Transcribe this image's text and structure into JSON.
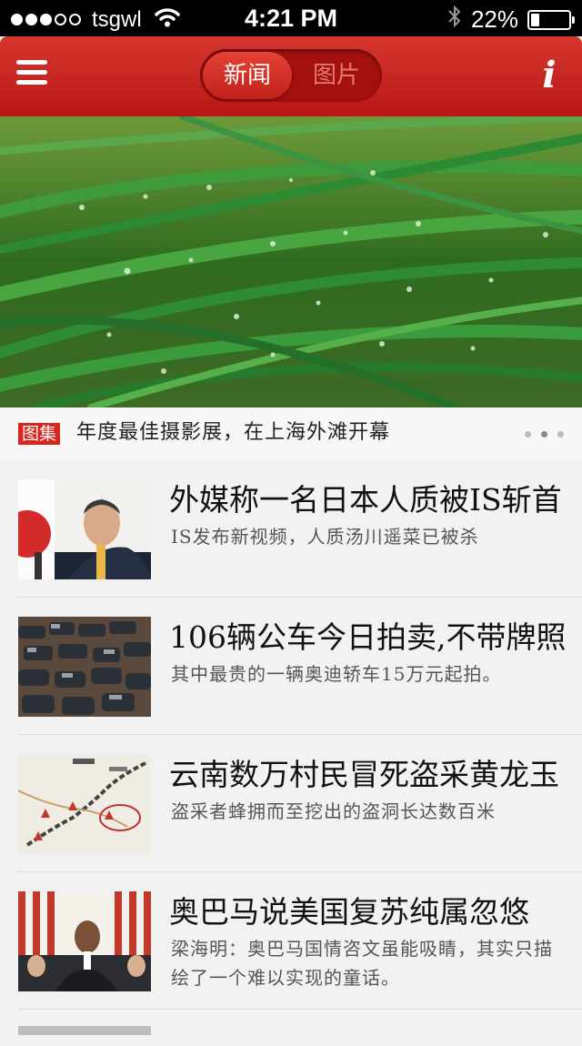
{
  "status_bar": {
    "carrier": "tsgwl",
    "time": "4:21 PM",
    "battery": "22%",
    "battery_level": 0.22,
    "signal_bars": 3,
    "icons": [
      "signal-dots-icon",
      "wifi-icon",
      "bluetooth-icon",
      "battery-icon"
    ]
  },
  "nav": {
    "menu_icon": "hamburger-menu-icon",
    "tabs": [
      {
        "label": "新闻",
        "active": true
      },
      {
        "label": "图片",
        "active": false
      }
    ],
    "info_label": "i",
    "accent_color": "#c8241e"
  },
  "hero": {
    "tag": "图集",
    "title": "年度最佳摄影展，在上海外滩开幕",
    "image": "green-grass-dewdrops",
    "pager": {
      "count": 3,
      "active": 1
    }
  },
  "news": [
    {
      "title": "外媒称一名日本人质被IS斩首",
      "summary": "IS发布新视频，人质汤川遥菜已被杀",
      "thumbnail": "politician-press-photo"
    },
    {
      "title": "106辆公车今日拍卖,不带牌照",
      "summary": "其中最贵的一辆奥迪轿车15万元起拍。",
      "thumbnail": "parked-cars-photo"
    },
    {
      "title": "云南数万村民冒死盗采黄龙玉",
      "summary": "盗采者蜂拥而至挖出的盗洞长达数百米",
      "thumbnail": "route-map-image"
    },
    {
      "title": "奥巴马说美国复苏纯属忽悠",
      "summary": "梁海明：奥巴马国情咨文虽能吸睛，其实只描绘了一个难以实现的童话。",
      "thumbnail": "obama-speech-photo"
    }
  ]
}
